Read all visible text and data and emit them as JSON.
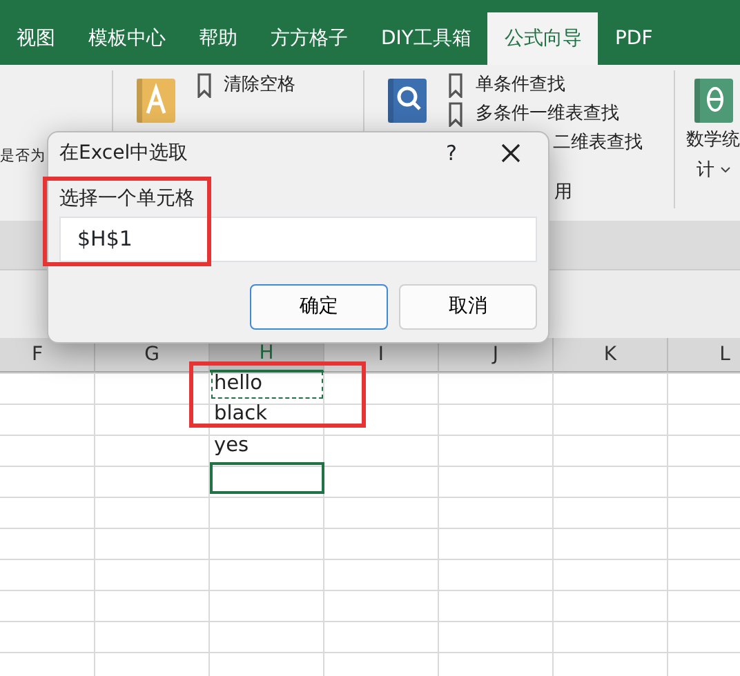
{
  "tabs": [
    {
      "label": "视图",
      "selected": false
    },
    {
      "label": "模板中心",
      "selected": false
    },
    {
      "label": "帮助",
      "selected": false
    },
    {
      "label": "方方格子",
      "selected": false
    },
    {
      "label": "DIY工具箱",
      "selected": false
    },
    {
      "label": "公式向导",
      "selected": true
    },
    {
      "label": "PDF",
      "selected": false
    }
  ],
  "ribbon": {
    "left_fragment": "是否为",
    "groups": [
      {
        "kind": "text-tools",
        "commands": [
          "清除空格"
        ]
      },
      {
        "kind": "lookup",
        "commands": [
          "单条件查找",
          "多条件一维表查找",
          "二维表查找"
        ],
        "caption": "用"
      },
      {
        "kind": "math",
        "label": "数学统",
        "label_2": "计"
      }
    ]
  },
  "dialog": {
    "title": "在Excel中选取",
    "help": "?",
    "prompt": "选择一个单元格",
    "value": "$H$1",
    "buttons": [
      {
        "label": "确定",
        "default": true
      },
      {
        "label": "取消",
        "default": false
      }
    ]
  },
  "sheet": {
    "columns": [
      {
        "label": "F",
        "selected": false
      },
      {
        "label": "G",
        "selected": false
      },
      {
        "label": "H",
        "selected": true
      },
      {
        "label": "I",
        "selected": false
      },
      {
        "label": "J",
        "selected": false
      },
      {
        "label": "K",
        "selected": false
      },
      {
        "label": "L",
        "selected": false
      }
    ],
    "rows": [
      {
        "text": "hello",
        "copied": true,
        "active": false
      },
      {
        "text": "black",
        "copied": false,
        "active": false
      },
      {
        "text": "yes",
        "copied": false,
        "active": false
      },
      {
        "copied": false,
        "active": true
      }
    ]
  }
}
